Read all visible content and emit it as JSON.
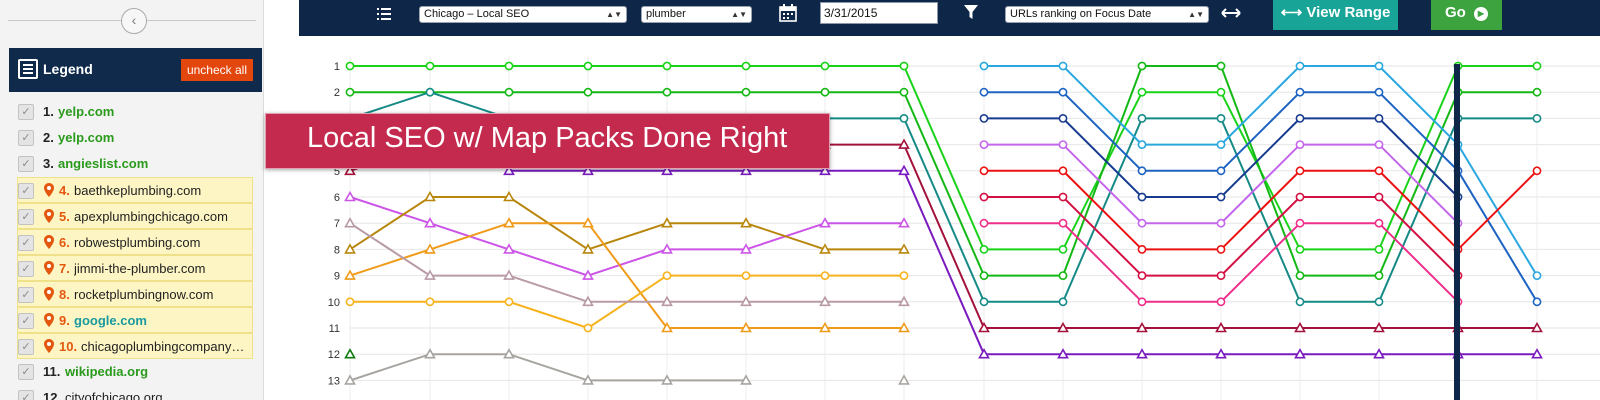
{
  "sidebar": {
    "collapse_icon": "‹",
    "legend": {
      "title": "Legend",
      "uncheck_all_label": "uncheck all",
      "items": [
        {
          "num": "1.",
          "domain": "yelp.com",
          "color": "#2a9a1c",
          "highlight": false,
          "bold": true
        },
        {
          "num": "2.",
          "domain": "yelp.com",
          "color": "#2a9a1c",
          "highlight": false,
          "bold": true
        },
        {
          "num": "3.",
          "domain": "angieslist.com",
          "color": "#2a9a1c",
          "highlight": false,
          "bold": true
        },
        {
          "num": "4.",
          "domain": "baethkeplumbing.com",
          "color": "#222222",
          "highlight": true,
          "bold": false
        },
        {
          "num": "5.",
          "domain": "apexplumbingchicago.com",
          "color": "#222222",
          "highlight": true,
          "bold": false
        },
        {
          "num": "6.",
          "domain": "robwestplumbing.com",
          "color": "#222222",
          "highlight": true,
          "bold": false
        },
        {
          "num": "7.",
          "domain": "jimmi-the-plumber.com",
          "color": "#222222",
          "highlight": true,
          "bold": false
        },
        {
          "num": "8.",
          "domain": "rocketplumbingnow.com",
          "color": "#222222",
          "highlight": true,
          "bold": false
        },
        {
          "num": "9.",
          "domain": "google.com",
          "color": "#1a9aa0",
          "highlight": true,
          "bold": true
        },
        {
          "num": "10.",
          "domain": "chicagoplumbingcompany…",
          "color": "#222222",
          "highlight": true,
          "bold": false
        },
        {
          "num": "11.",
          "domain": "wikipedia.org",
          "color": "#2a9a1c",
          "highlight": false,
          "bold": true
        },
        {
          "num": "12.",
          "domain": "cityofchicago.org",
          "color": "#222222",
          "highlight": false,
          "bold": false
        }
      ]
    }
  },
  "toolbar": {
    "list_icon": "list-icon",
    "location_select": "Chicago – Local SEO",
    "keyword_select": "plumber",
    "calendar_icon": "calendar-icon",
    "date_value": "3/31/2015",
    "filter_icon": "filter-icon",
    "ranking_select": "URLs ranking on Focus Date",
    "range_icon": "arrows-horizontal-icon",
    "view_range_label": "View Range",
    "go_label": "Go"
  },
  "banner": {
    "text": "Local SEO w/ Map Packs Done Right",
    "color": "#c42a4e"
  },
  "chart_data": {
    "type": "line",
    "ylabels": [
      "1",
      "2",
      "3",
      "4",
      "5",
      "6",
      "7",
      "8",
      "9",
      "10",
      "11",
      "12",
      "13"
    ],
    "ylim": [
      1,
      13
    ],
    "y_inverted": true,
    "x": [
      1,
      2,
      3,
      4,
      5,
      6,
      7,
      8,
      9,
      10,
      11,
      12,
      13,
      14,
      15,
      16,
      17
    ],
    "grid": true,
    "series": [
      {
        "color": "#19d319",
        "marker": "circle",
        "values": [
          1,
          1,
          1,
          1,
          1,
          1,
          1,
          1,
          8,
          8,
          2,
          2,
          8,
          8,
          1,
          1,
          null
        ]
      },
      {
        "color": "#14b814",
        "marker": "circle",
        "values": [
          2,
          2,
          2,
          2,
          2,
          2,
          2,
          2,
          9,
          9,
          1,
          1,
          9,
          9,
          2,
          2,
          null
        ]
      },
      {
        "color": "#158a86",
        "marker": "circle",
        "values": [
          3,
          2,
          3,
          3,
          3,
          3,
          3,
          3,
          10,
          10,
          3,
          3,
          10,
          10,
          3,
          3,
          null
        ]
      },
      {
        "color": "#2aa7e0",
        "marker": "circle",
        "values": [
          null,
          null,
          null,
          null,
          null,
          null,
          null,
          null,
          1,
          1,
          4,
          4,
          1,
          1,
          4,
          9,
          null
        ]
      },
      {
        "color": "#1e63c2",
        "marker": "circle",
        "values": [
          null,
          null,
          null,
          null,
          null,
          null,
          null,
          null,
          2,
          2,
          5,
          5,
          2,
          2,
          5,
          10,
          null
        ]
      },
      {
        "color": "#173c8f",
        "marker": "circle",
        "values": [
          null,
          null,
          null,
          null,
          null,
          null,
          null,
          null,
          3,
          3,
          6,
          6,
          3,
          3,
          6,
          null,
          null
        ]
      },
      {
        "color": "#c466ec",
        "marker": "circle",
        "values": [
          null,
          null,
          null,
          null,
          null,
          null,
          null,
          null,
          4,
          4,
          7,
          7,
          4,
          4,
          7,
          null,
          null
        ]
      },
      {
        "color": "#ec1111",
        "marker": "circle",
        "values": [
          null,
          null,
          null,
          null,
          null,
          null,
          null,
          null,
          5,
          5,
          8,
          8,
          5,
          5,
          8,
          5,
          null
        ]
      },
      {
        "color": "#d31243",
        "marker": "circle",
        "values": [
          null,
          null,
          null,
          null,
          null,
          null,
          null,
          null,
          6,
          6,
          9,
          9,
          6,
          6,
          9,
          null,
          null
        ]
      },
      {
        "color": "#ee2f8a",
        "marker": "circle",
        "values": [
          null,
          null,
          null,
          null,
          null,
          null,
          null,
          null,
          7,
          7,
          10,
          10,
          7,
          7,
          10,
          null,
          null
        ]
      },
      {
        "color": "#a3123a",
        "marker": "triangle",
        "values": [
          5,
          4,
          4,
          4,
          4,
          4,
          4,
          4,
          11,
          11,
          11,
          11,
          11,
          11,
          11,
          11,
          null
        ]
      },
      {
        "color": "#7a1bbf",
        "marker": "triangle",
        "values": [
          null,
          null,
          5,
          5,
          5,
          5,
          5,
          5,
          12,
          12,
          12,
          12,
          12,
          12,
          12,
          12,
          null
        ]
      },
      {
        "color": "#cc55e8",
        "marker": "triangle",
        "values": [
          6,
          7,
          8,
          9,
          8,
          8,
          7,
          7,
          null,
          null,
          null,
          null,
          null,
          null,
          null,
          null,
          null
        ]
      },
      {
        "color": "#b8860b",
        "marker": "triangle",
        "values": [
          8,
          6,
          6,
          8,
          7,
          7,
          8,
          8,
          null,
          null,
          null,
          null,
          null,
          null,
          null,
          null,
          null
        ]
      },
      {
        "color": "#f09a1a",
        "marker": "triangle",
        "values": [
          9,
          8,
          7,
          7,
          11,
          11,
          11,
          11,
          null,
          null,
          null,
          null,
          null,
          null,
          null,
          null,
          null
        ]
      },
      {
        "color": "#f7b21c",
        "marker": "circle",
        "values": [
          10,
          10,
          10,
          11,
          9,
          9,
          9,
          9,
          null,
          null,
          null,
          null,
          null,
          null,
          null,
          null,
          null
        ]
      },
      {
        "color": "#b89aa6",
        "marker": "triangle",
        "values": [
          7,
          9,
          9,
          10,
          10,
          10,
          10,
          10,
          null,
          null,
          null,
          null,
          null,
          null,
          null,
          null,
          null
        ]
      },
      {
        "color": "#a7a4a0",
        "marker": "triangle",
        "values": [
          13,
          12,
          12,
          13,
          13,
          13,
          null,
          13,
          null,
          null,
          null,
          null,
          null,
          null,
          null,
          null,
          null
        ]
      },
      {
        "color": "#117a11",
        "marker": "triangle",
        "values": [
          12,
          null,
          null,
          null,
          null,
          null,
          null,
          null,
          null,
          null,
          null,
          null,
          null,
          null,
          null,
          null,
          null
        ]
      }
    ]
  }
}
